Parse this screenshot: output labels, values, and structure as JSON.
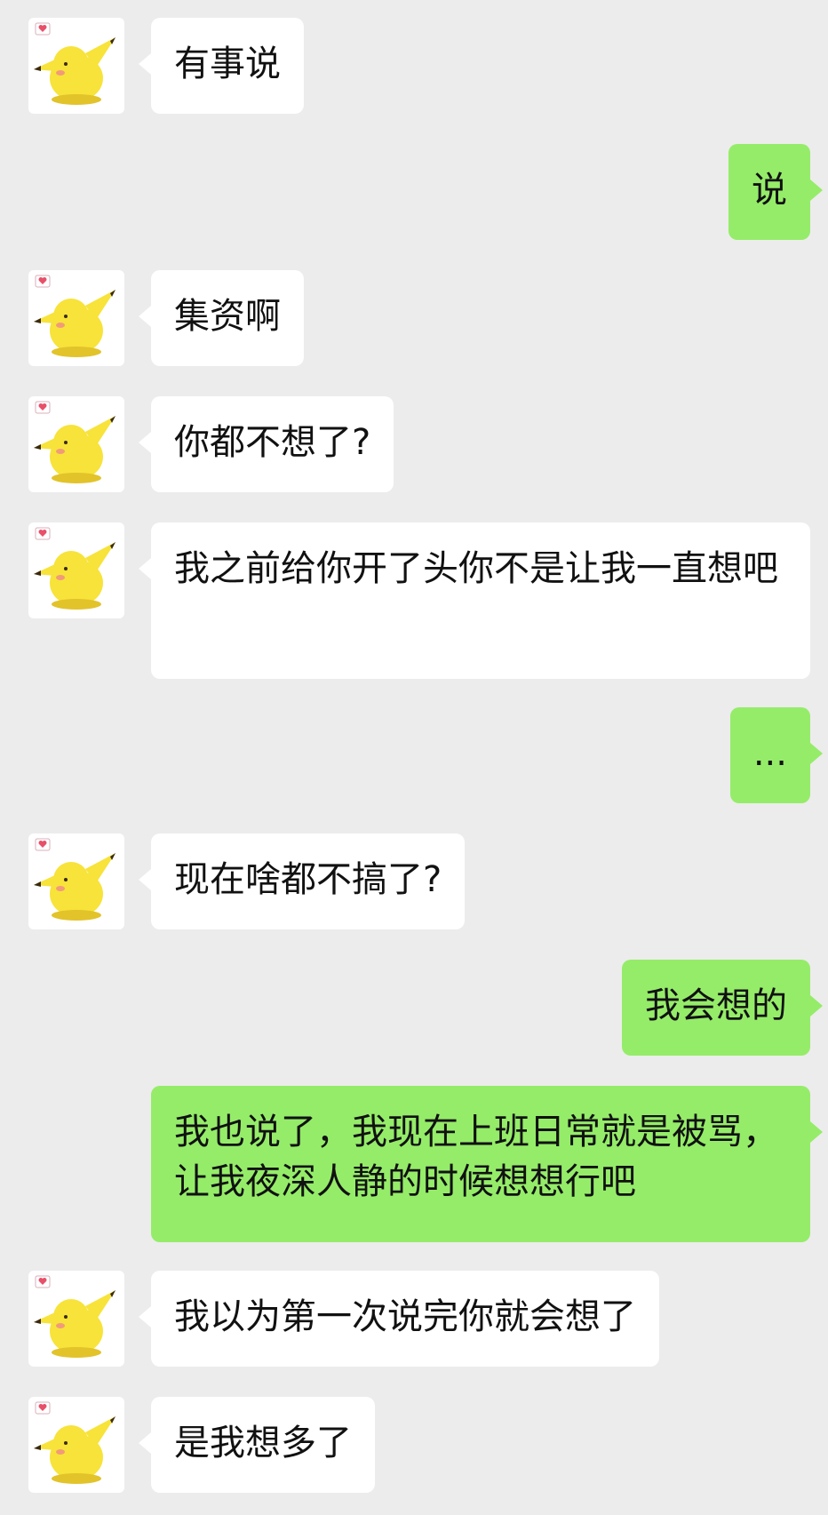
{
  "chat": {
    "messages": [
      {
        "sender": "other",
        "text": "有事说"
      },
      {
        "sender": "me",
        "text": "说"
      },
      {
        "sender": "other",
        "text": "集资啊"
      },
      {
        "sender": "other",
        "text": "你都不想了?"
      },
      {
        "sender": "other",
        "text": "我之前给你开了头你不是让我一直想吧"
      },
      {
        "sender": "me",
        "text": "..."
      },
      {
        "sender": "other",
        "text": "现在啥都不搞了?"
      },
      {
        "sender": "me",
        "text": "我会想的"
      },
      {
        "sender": "me",
        "text": "我也说了，我现在上班日常就是被骂，让我夜深人静的时候想想行吧"
      },
      {
        "sender": "other",
        "text": "我以为第一次说完你就会想了"
      },
      {
        "sender": "other",
        "text": "是我想多了"
      }
    ]
  },
  "avatar": {
    "icon": "pikachu-avatar-icon",
    "heart_color": "#e8506a",
    "body_color": "#f7e33a"
  },
  "colors": {
    "background": "#ececec",
    "incoming_bubble": "#ffffff",
    "outgoing_bubble": "#95ec69"
  }
}
